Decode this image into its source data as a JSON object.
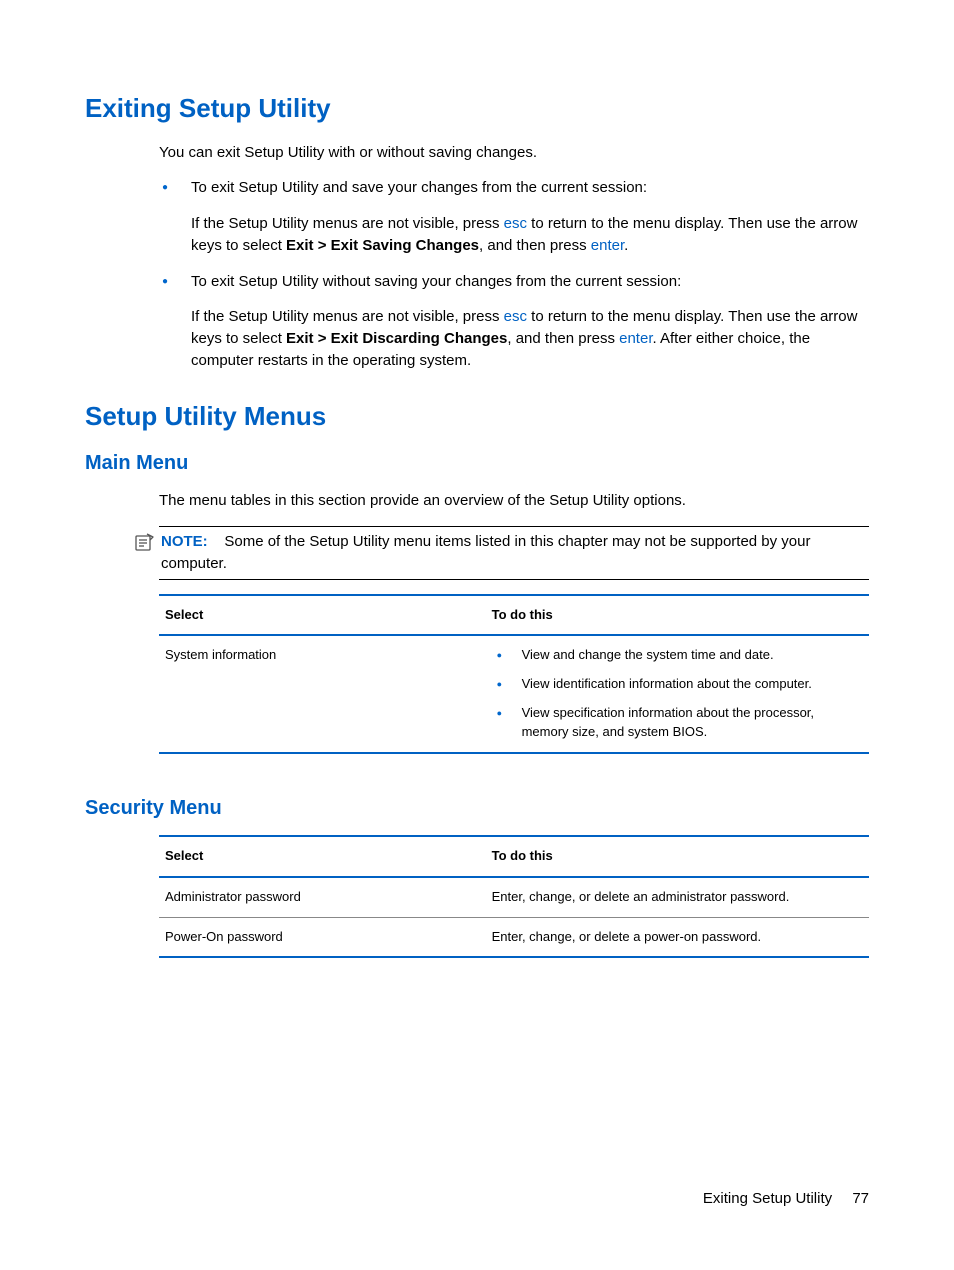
{
  "section1": {
    "heading": "Exiting Setup Utility",
    "intro": "You can exit Setup Utility with or without saving changes.",
    "bullets": [
      {
        "lead": "To exit Setup Utility and save your changes from the current session:",
        "sub_pre": "If the Setup Utility menus are not visible, press ",
        "key1": "esc",
        "sub_mid": " to return to the menu display. Then use the arrow keys to select ",
        "bold": "Exit > Exit Saving Changes",
        "sub_mid2": ", and then press ",
        "key2": "enter",
        "sub_post": "."
      },
      {
        "lead": "To exit Setup Utility without saving your changes from the current session:",
        "sub_pre": "If the Setup Utility menus are not visible, press ",
        "key1": "esc",
        "sub_mid": " to return to the menu display. Then use the arrow keys to select ",
        "bold": "Exit > Exit Discarding Changes",
        "sub_mid2": ", and then press ",
        "key2": "enter",
        "sub_post": ". After either choice, the computer restarts in the operating system."
      }
    ]
  },
  "section2": {
    "heading": "Setup Utility Menus",
    "sub1_heading": "Main Menu",
    "sub1_intro": "The menu tables in this section provide an overview of the Setup Utility options.",
    "note_label": "NOTE:",
    "note_text": "Some of the Setup Utility menu items listed in this chapter may not be supported by your computer.",
    "table1": {
      "headers": [
        "Select",
        "To do this"
      ],
      "row_label": "System information",
      "row_items": [
        "View and change the system time and date.",
        "View identification information about the computer.",
        "View specification information about the processor, memory size, and system BIOS."
      ]
    },
    "sub2_heading": "Security Menu",
    "table2": {
      "headers": [
        "Select",
        "To do this"
      ],
      "rows": [
        {
          "select": "Administrator password",
          "do": "Enter, change, or delete an administrator password."
        },
        {
          "select": "Power-On password",
          "do": "Enter, change, or delete a power-on password."
        }
      ]
    }
  },
  "footer": {
    "text": "Exiting Setup Utility",
    "page": "77"
  }
}
